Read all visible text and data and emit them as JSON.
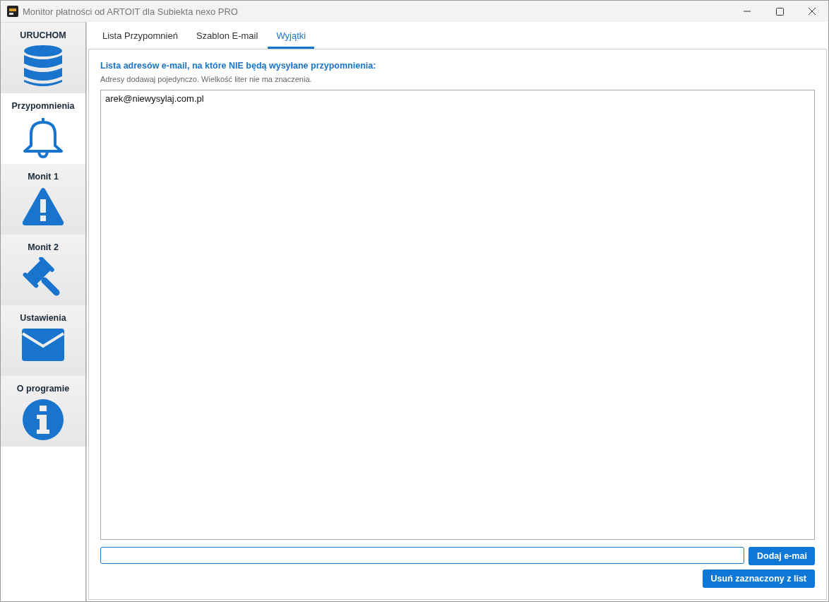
{
  "window": {
    "title": "Monitor płatności od ARTOIT dla Subiekta nexo PRO"
  },
  "sidebar": {
    "items": [
      {
        "label": "URUCHOM",
        "kind": "database",
        "selected": false
      },
      {
        "label": "Przypomnienia",
        "kind": "bell",
        "selected": true
      },
      {
        "label": "Monit 1",
        "kind": "warning",
        "selected": false
      },
      {
        "label": "Monit 2",
        "kind": "gavel",
        "selected": false
      },
      {
        "label": "Ustawienia",
        "kind": "envelope",
        "selected": false
      },
      {
        "label": "O programie",
        "kind": "info",
        "selected": false
      }
    ]
  },
  "tabs": [
    {
      "label": "Lista Przypomnień",
      "selected": false
    },
    {
      "label": "Szablon E-mail",
      "selected": false
    },
    {
      "label": "Wyjątki",
      "selected": true
    }
  ],
  "panel": {
    "heading": "Lista adresów e-mail, na które NIE będą wysyłane przypomnienia:",
    "hint": "Adresy dodawaj pojedynczo. Wielkość liter nie ma znaczenia.",
    "list": [
      "arek@niewysylaj.com.pl"
    ],
    "add_button": "Dodaj e-mai",
    "remove_button": "Usuń zaznaczony z list"
  }
}
